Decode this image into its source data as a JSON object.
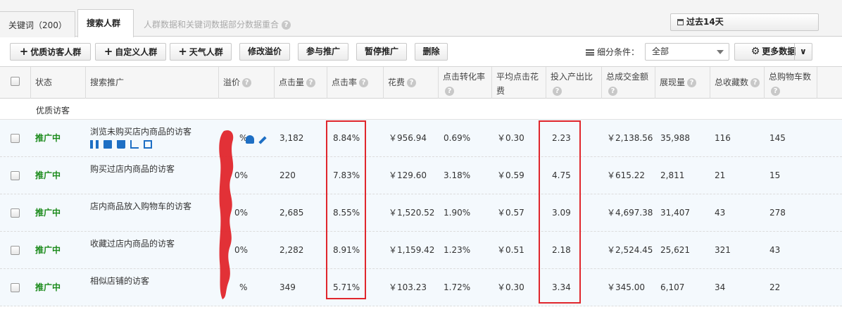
{
  "tabs": [
    {
      "label": "关键词（200）"
    },
    {
      "label": "搜索人群"
    }
  ],
  "tab_note": "人群数据和关键词数据部分数据重合",
  "date_range": "过去14天",
  "toolbar": {
    "buttons": [
      {
        "label": "优质访客人群",
        "icon": "plus"
      },
      {
        "label": "自定义人群",
        "icon": "plus"
      },
      {
        "label": "天气人群",
        "icon": "plus"
      },
      {
        "label": "修改溢价"
      },
      {
        "label": "参与推广"
      },
      {
        "label": "暂停推广"
      },
      {
        "label": "删除"
      }
    ],
    "segment_label": "细分条件：",
    "segment_value": "全部",
    "more_data": "更多数据"
  },
  "table": {
    "headers": [
      "状态",
      "搜索推广",
      "溢价",
      "点击量",
      "点击率",
      "花费",
      "点击转化率",
      "平均点击花费",
      "投入产出比",
      "总成交金额",
      "展现量",
      "总收藏数",
      "总购物车数"
    ],
    "group_label": "优质访客",
    "rows": [
      {
        "status": "推广中",
        "name": "浏览未购买店内商品的访客",
        "bid": "%",
        "clicks": "3,182",
        "ctr": "8.84%",
        "cost": "￥956.94",
        "cvr": "0.69%",
        "cpc": "￥0.30",
        "roi": "2.23",
        "gmv": "￥2,138.56",
        "impressions": "35,988",
        "favorites": "116",
        "cart": "145"
      },
      {
        "status": "推广中",
        "name": "购买过店内商品的访客",
        "bid": "0%",
        "clicks": "220",
        "ctr": "7.83%",
        "cost": "￥129.60",
        "cvr": "3.18%",
        "cpc": "￥0.59",
        "roi": "4.75",
        "gmv": "￥615.22",
        "impressions": "2,811",
        "favorites": "21",
        "cart": "15"
      },
      {
        "status": "推广中",
        "name": "店内商品放入购物车的访客",
        "bid": "0%",
        "clicks": "2,685",
        "ctr": "8.55%",
        "cost": "￥1,520.52",
        "cvr": "1.90%",
        "cpc": "￥0.57",
        "roi": "3.09",
        "gmv": "￥4,697.38",
        "impressions": "31,407",
        "favorites": "43",
        "cart": "278"
      },
      {
        "status": "推广中",
        "name": "收藏过店内商品的访客",
        "bid": "0%",
        "clicks": "2,282",
        "ctr": "8.91%",
        "cost": "￥1,159.42",
        "cvr": "1.23%",
        "cpc": "￥0.51",
        "roi": "2.18",
        "gmv": "￥2,524.45",
        "impressions": "25,621",
        "favorites": "321",
        "cart": "43"
      },
      {
        "status": "推广中",
        "name": "相似店铺的访客",
        "bid": "%",
        "clicks": "349",
        "ctr": "5.71%",
        "cost": "￥103.23",
        "cvr": "1.72%",
        "cpc": "￥0.30",
        "roi": "3.34",
        "gmv": "￥345.00",
        "impressions": "6,107",
        "favorites": "34",
        "cart": "22"
      }
    ]
  },
  "colors": {
    "status_green": "#1a8a1a",
    "annotation_red": "#e0262c",
    "action_blue": "#1e6fc4"
  }
}
